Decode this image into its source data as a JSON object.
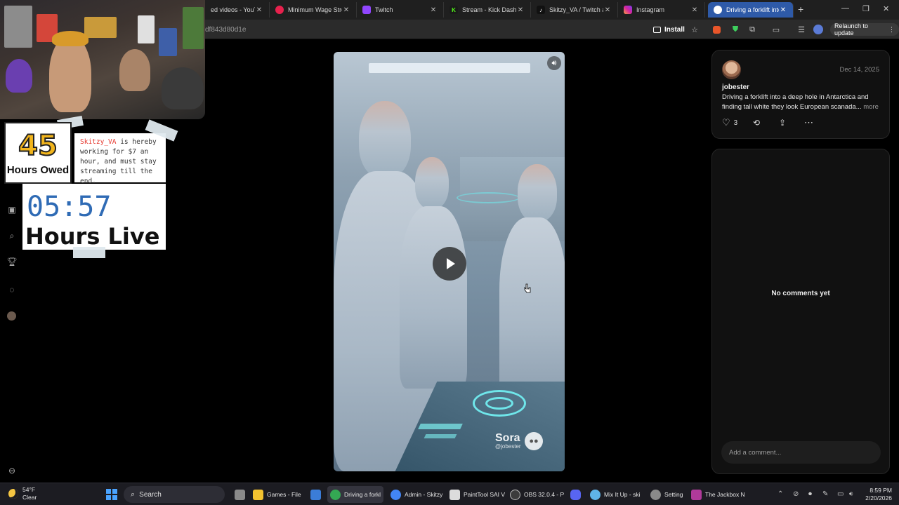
{
  "browser": {
    "tabs": [
      {
        "title": "ed videos - YouTub",
        "color": "#ff0000",
        "glyph": ""
      },
      {
        "title": "Minimum Wage Strea",
        "color": "#e8214d",
        "glyph": ""
      },
      {
        "title": "Twitch",
        "color": "#9146ff",
        "glyph": ""
      },
      {
        "title": "Stream - Kick Dashbo",
        "color": "#53fc18",
        "glyph": "K"
      },
      {
        "title": "Skitzy_VA / Twitch an",
        "color": "#111111",
        "glyph": "♪"
      },
      {
        "title": "Instagram",
        "color": "#d6249f",
        "glyph": ""
      },
      {
        "title": "Driving a forklift into",
        "color": "#ffffff",
        "glyph": ""
      }
    ],
    "new_tab": "+",
    "url_fragment": "df843d80d1e",
    "install_label": "Install",
    "relaunch_label": "Relaunch to update"
  },
  "overlay": {
    "hours_owed_value": "45",
    "hours_owed_label": "Hours Owed",
    "note_user": "Skitzy_VA",
    "note_rest": " is hereby working for $7 an hour, and must stay streaming till the end.",
    "live_time": "05:57",
    "live_label": "Hours Live"
  },
  "video": {
    "watermark_name": "Sora",
    "watermark_handle": "@jobester"
  },
  "post": {
    "date": "Dec 14, 2025",
    "username": "jobester",
    "caption": "Driving a forklift into a deep hole in Antarctica and finding tall white they look European scanada...",
    "more_label": "more",
    "like_count": "3"
  },
  "comments": {
    "empty_label": "No comments yet",
    "input_placeholder": "Add a comment..."
  },
  "taskbar": {
    "weather_temp": "54°F",
    "weather_cond": "Clear",
    "search_label": "Search",
    "apps": [
      {
        "label": "Games - File",
        "color": "#f2c230"
      },
      {
        "label": "Driving a forkl",
        "color": "#34a853"
      },
      {
        "label": "Admin - Skitzy",
        "color": "#4285f4"
      },
      {
        "label": "PaintTool SAI V",
        "color": "#dcdcdc"
      },
      {
        "label": "OBS 32.0.4 - P",
        "color": "#3c3c3c"
      },
      {
        "label": "Mix It Up - ski",
        "color": "#5fb4e8"
      },
      {
        "label": "Setting",
        "color": "#8a8a8a"
      },
      {
        "label": "The Jackbox N",
        "color": "#b03a9a"
      }
    ],
    "time": "8:59 PM",
    "date": "2/20/2026"
  }
}
